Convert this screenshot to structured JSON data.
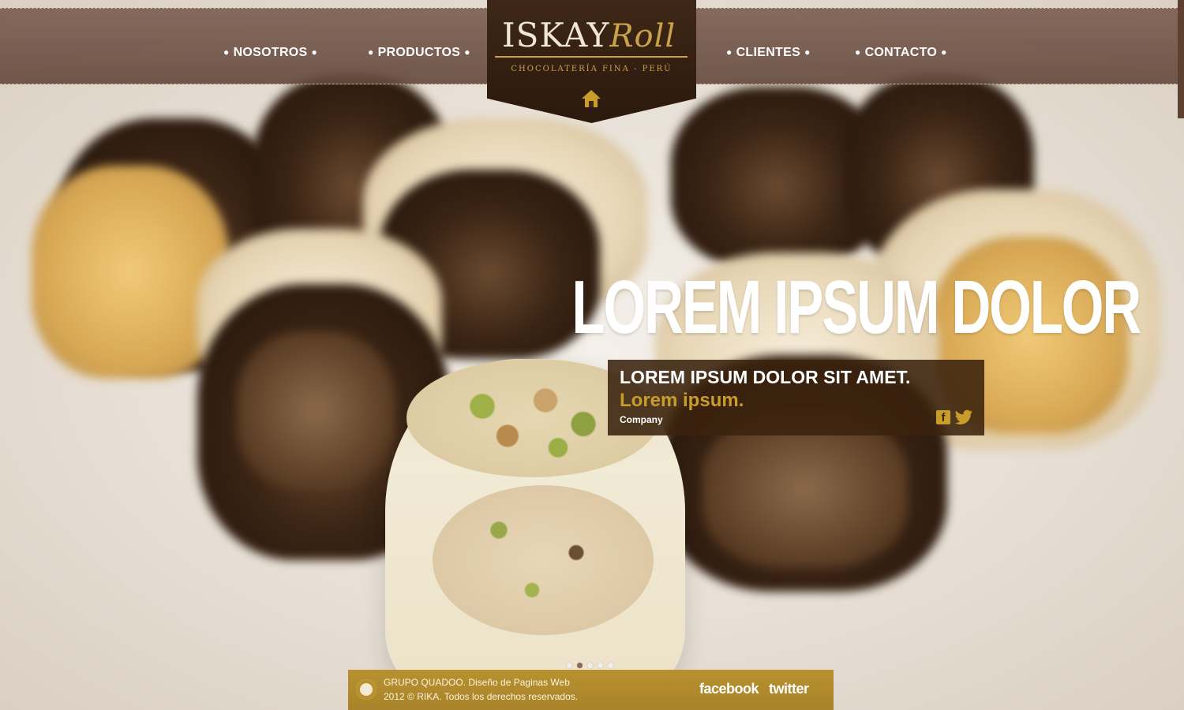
{
  "nav": {
    "items": [
      {
        "label": "NOSOTROS"
      },
      {
        "label": "PRODUCTOS"
      },
      {
        "label": "CLIENTES"
      },
      {
        "label": "CONTACTO"
      }
    ]
  },
  "logo": {
    "brand": "ISKAY",
    "script": "Roll",
    "tagline": "CHOCOLATERÍA FINA - PERÚ",
    "icon": "home-icon"
  },
  "hero": {
    "headline": "LOREM IPSUM DOLOR",
    "caption_title": "LOREM IPSUM DOLOR SIT AMET.",
    "caption_subtitle": "Lorem ipsum.",
    "caption_company": "Company",
    "share_icons": [
      "facebook-icon",
      "twitter-icon"
    ]
  },
  "slider": {
    "total_slides": 5,
    "active_slide": 2
  },
  "footer": {
    "line1": "GRUPO QUADOO. Diseño de Paginas Web",
    "line2": "2012 © RIKA. Todos los derechos reservados.",
    "facebook_label": "facebook",
    "twitter_label": "twitter"
  },
  "colors": {
    "nav_bar": "#6e5044",
    "logo_badge": "#2f1c10",
    "gold_accent": "#c99d2c",
    "caption_bg": "#3a220e",
    "footer_bg": "#b08a2c"
  }
}
